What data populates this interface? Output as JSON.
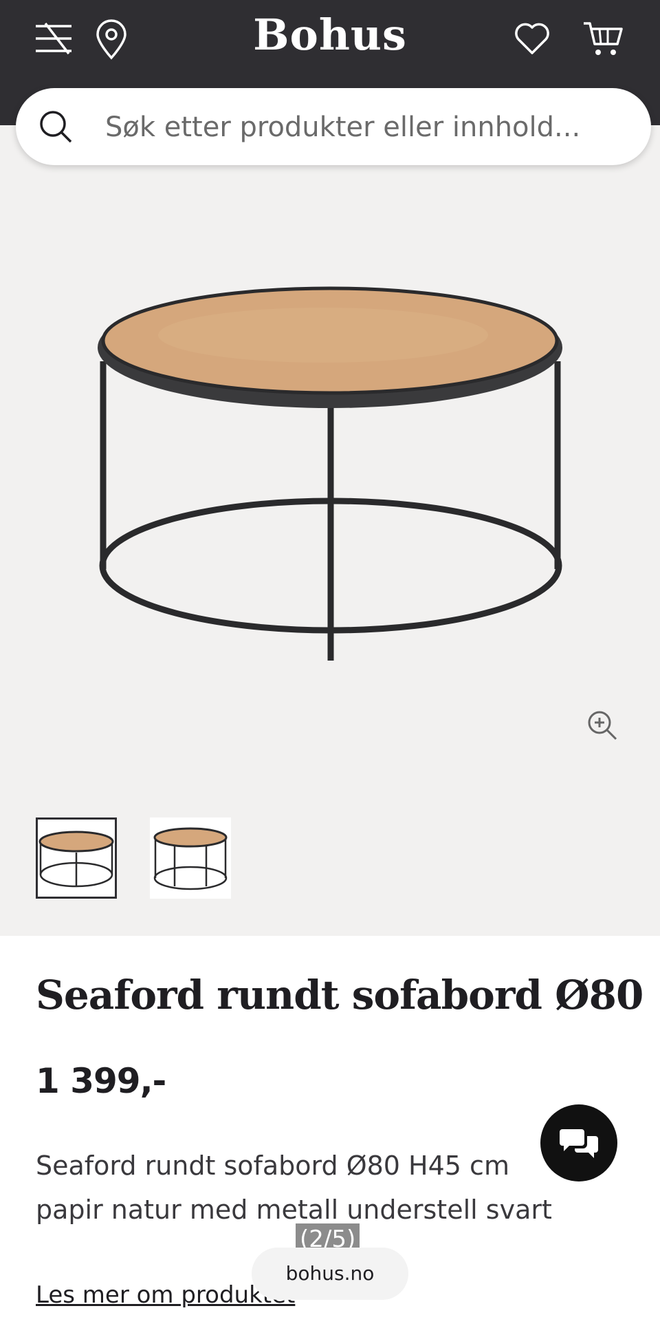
{
  "header": {
    "logo": "Bohus",
    "icons": [
      "menu-icon",
      "location-pin-icon",
      "heart-icon",
      "cart-icon"
    ],
    "background_color": "#2f2e32"
  },
  "search": {
    "placeholder": "Søk etter produkter eller innhold..."
  },
  "gallery": {
    "background_color": "#f2f1f0",
    "thumbnails": [
      "thumbnail-1",
      "thumbnail-2"
    ],
    "active_thumbnail": 1
  },
  "product": {
    "title": "Seaford rundt sofabord Ø80",
    "price": "1 399,-",
    "description": "Seaford rundt sofabord Ø80 H45 cm papir natur med metall understell svart",
    "read_more": "Les mer om produktet"
  },
  "overlay": {
    "counter": "(2/5)",
    "domain": "bohus.no"
  }
}
